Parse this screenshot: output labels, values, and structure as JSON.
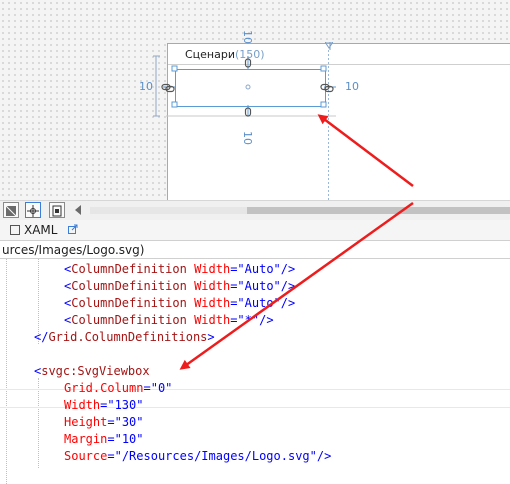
{
  "designer": {
    "window_title": "Сценари",
    "column_width": "(150)",
    "margins": {
      "top": "10",
      "left": "10",
      "right": "10",
      "bottom": "10"
    }
  },
  "editor_tabs": {
    "xaml": "XAML"
  },
  "path": "urces/Images/Logo.svg)",
  "code": [
    {
      "indent": 64,
      "parts": [
        {
          "c": "br",
          "t": "<"
        },
        {
          "c": "el",
          "t": "ColumnDefinition"
        },
        {
          "c": "sp",
          "t": " "
        },
        {
          "c": "at",
          "t": "Width"
        },
        {
          "c": "eq",
          "t": "="
        },
        {
          "c": "va",
          "t": "\"Auto\""
        },
        {
          "c": "br",
          "t": "/>"
        }
      ]
    },
    {
      "indent": 64,
      "parts": [
        {
          "c": "br",
          "t": "<"
        },
        {
          "c": "el",
          "t": "ColumnDefinition"
        },
        {
          "c": "sp",
          "t": " "
        },
        {
          "c": "at",
          "t": "Width"
        },
        {
          "c": "eq",
          "t": "="
        },
        {
          "c": "va",
          "t": "\"Auto\""
        },
        {
          "c": "br",
          "t": "/>"
        }
      ]
    },
    {
      "indent": 64,
      "parts": [
        {
          "c": "br",
          "t": "<"
        },
        {
          "c": "el",
          "t": "ColumnDefinition"
        },
        {
          "c": "sp",
          "t": " "
        },
        {
          "c": "at",
          "t": "Width"
        },
        {
          "c": "eq",
          "t": "="
        },
        {
          "c": "va",
          "t": "\"Auto\""
        },
        {
          "c": "br",
          "t": "/>"
        }
      ]
    },
    {
      "indent": 64,
      "parts": [
        {
          "c": "br",
          "t": "<"
        },
        {
          "c": "el",
          "t": "ColumnDefinition"
        },
        {
          "c": "sp",
          "t": " "
        },
        {
          "c": "at",
          "t": "Width"
        },
        {
          "c": "eq",
          "t": "="
        },
        {
          "c": "va",
          "t": "\"*\""
        },
        {
          "c": "br",
          "t": "/>"
        }
      ]
    },
    {
      "indent": 34,
      "parts": [
        {
          "c": "br",
          "t": "</"
        },
        {
          "c": "el",
          "t": "Grid.ColumnDefinitions"
        },
        {
          "c": "br",
          "t": ">"
        }
      ]
    },
    {
      "indent": 0,
      "parts": []
    },
    {
      "indent": 34,
      "parts": [
        {
          "c": "br",
          "t": "<"
        },
        {
          "c": "el",
          "t": "svgc:SvgViewbox"
        }
      ]
    },
    {
      "indent": 64,
      "parts": [
        {
          "c": "at",
          "t": "Grid.Column"
        },
        {
          "c": "eq",
          "t": "="
        },
        {
          "c": "va",
          "t": "\"0\""
        }
      ]
    },
    {
      "indent": 64,
      "parts": [
        {
          "c": "at",
          "t": "Width"
        },
        {
          "c": "eq",
          "t": "="
        },
        {
          "c": "va",
          "t": "\"130\""
        }
      ]
    },
    {
      "indent": 64,
      "parts": [
        {
          "c": "at",
          "t": "Height"
        },
        {
          "c": "eq",
          "t": "="
        },
        {
          "c": "va",
          "t": "\"30\""
        }
      ]
    },
    {
      "indent": 64,
      "parts": [
        {
          "c": "at",
          "t": "Margin"
        },
        {
          "c": "eq",
          "t": "="
        },
        {
          "c": "va",
          "t": "\"10\""
        }
      ]
    },
    {
      "indent": 64,
      "parts": [
        {
          "c": "at",
          "t": "Source"
        },
        {
          "c": "eq",
          "t": "="
        },
        {
          "c": "va",
          "t": "\"/Resources/Images/Logo.svg\""
        },
        {
          "c": "br",
          "t": "/>"
        }
      ]
    }
  ],
  "colors": {
    "annotation_arrow": "#ee1c1c",
    "selection": "#5b9bd5",
    "xaml_bracket": "#0000ff",
    "xaml_element": "#a31515",
    "xaml_attribute": "#ff0000",
    "xaml_value": "#0000ff"
  }
}
